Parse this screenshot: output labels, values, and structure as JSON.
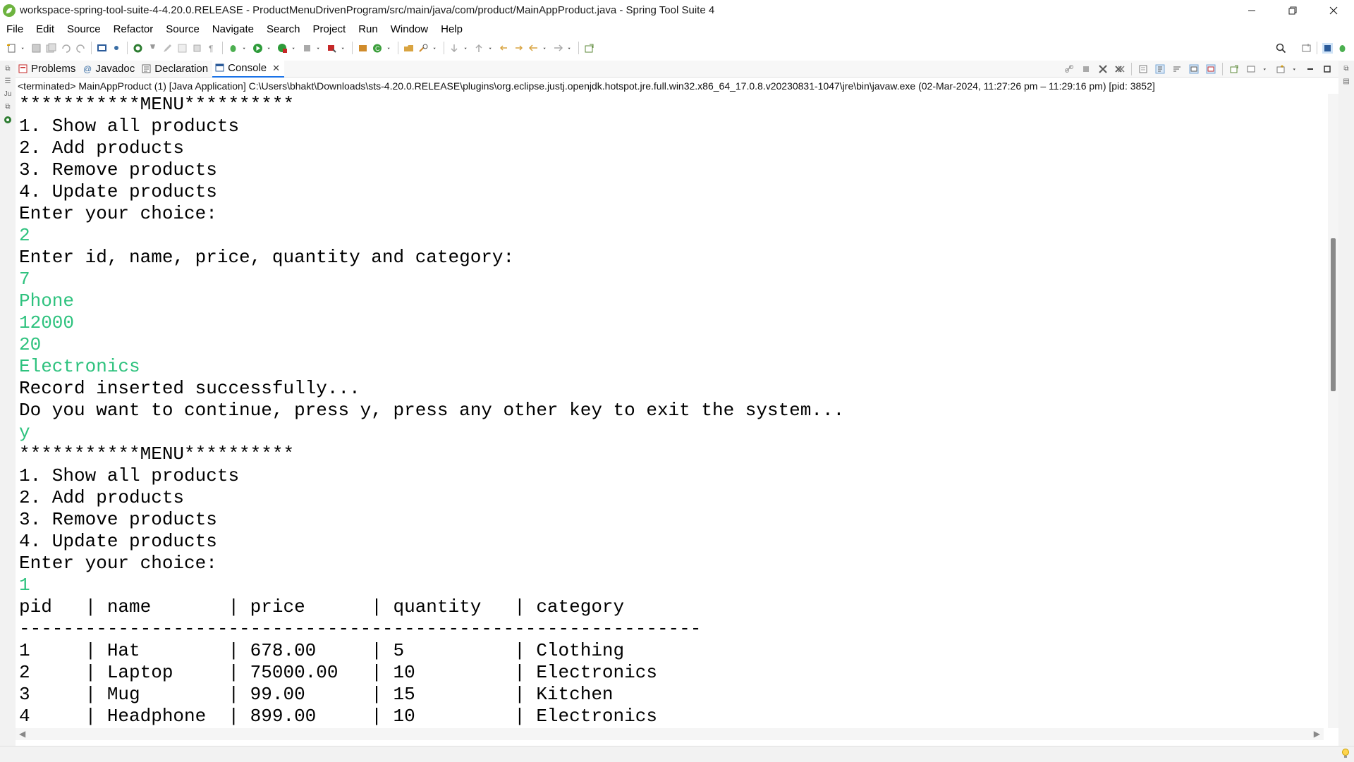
{
  "window": {
    "title": "workspace-spring-tool-suite-4-4.20.0.RELEASE - ProductMenuDrivenProgram/src/main/java/com/product/MainAppProduct.java - Spring Tool Suite 4"
  },
  "menubar": {
    "items": [
      "File",
      "Edit",
      "Source",
      "Refactor",
      "Source",
      "Navigate",
      "Search",
      "Project",
      "Run",
      "Window",
      "Help"
    ]
  },
  "view_tabs": [
    {
      "label": "Problems",
      "icon": "problems-icon"
    },
    {
      "label": "Javadoc",
      "icon": "javadoc-icon"
    },
    {
      "label": "Declaration",
      "icon": "declaration-icon"
    },
    {
      "label": "Console",
      "icon": "console-icon",
      "active": true
    }
  ],
  "console": {
    "status": "<terminated> MainAppProduct (1) [Java Application] C:\\Users\\bhakt\\Downloads\\sts-4.20.0.RELEASE\\plugins\\org.eclipse.justj.openjdk.hotspot.jre.full.win32.x86_64_17.0.8.v20230831-1047\\jre\\bin\\javaw.exe  (02-Mar-2024, 11:27:26 pm – 11:29:16 pm) [pid: 3852]",
    "lines": [
      {
        "text": "***********MENU**********",
        "input": false
      },
      {
        "text": "1. Show all products",
        "input": false
      },
      {
        "text": "2. Add products",
        "input": false
      },
      {
        "text": "3. Remove products",
        "input": false
      },
      {
        "text": "4. Update products",
        "input": false
      },
      {
        "text": "Enter your choice:",
        "input": false
      },
      {
        "text": "2",
        "input": true
      },
      {
        "text": "Enter id, name, price, quantity and category:",
        "input": false
      },
      {
        "text": "7",
        "input": true
      },
      {
        "text": "Phone",
        "input": true
      },
      {
        "text": "12000",
        "input": true
      },
      {
        "text": "20",
        "input": true
      },
      {
        "text": "Electronics",
        "input": true
      },
      {
        "text": "Record inserted successfully...",
        "input": false
      },
      {
        "text": "Do you want to continue, press y, press any other key to exit the system...",
        "input": false
      },
      {
        "text": "y",
        "input": true
      },
      {
        "text": "***********MENU**********",
        "input": false
      },
      {
        "text": "1. Show all products",
        "input": false
      },
      {
        "text": "2. Add products",
        "input": false
      },
      {
        "text": "3. Remove products",
        "input": false
      },
      {
        "text": "4. Update products",
        "input": false
      },
      {
        "text": "Enter your choice:",
        "input": false
      },
      {
        "text": "1",
        "input": true
      },
      {
        "text": "pid   | name       | price      | quantity   | category",
        "input": false
      },
      {
        "text": "--------------------------------------------------------------",
        "input": false
      },
      {
        "text": "1     | Hat        | 678.00     | 5          | Clothing",
        "input": false
      },
      {
        "text": "2     | Laptop     | 75000.00   | 10         | Electronics",
        "input": false
      },
      {
        "text": "3     | Mug        | 99.00      | 15         | Kitchen",
        "input": false
      },
      {
        "text": "4     | Headphone  | 899.00     | 10         | Electronics",
        "input": false
      }
    ]
  },
  "colors": {
    "input_text": "#2ec27e",
    "active_tab_underline": "#1a73e8"
  }
}
